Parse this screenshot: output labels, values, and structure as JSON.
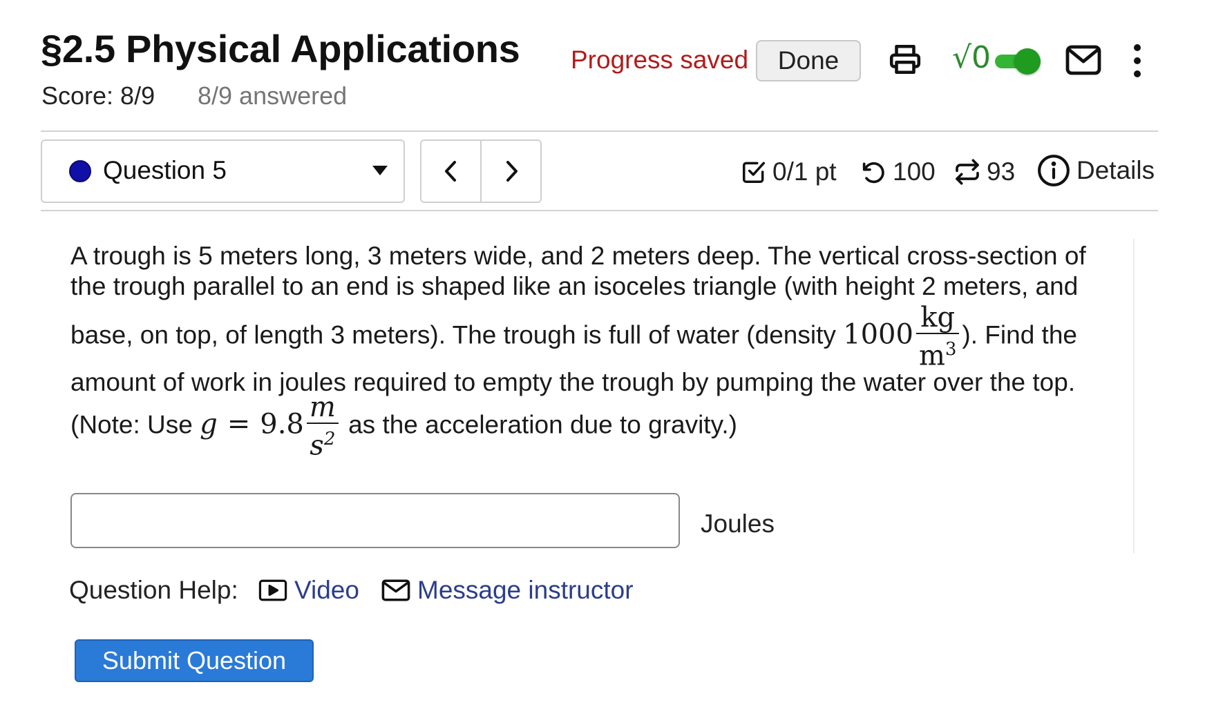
{
  "header": {
    "title": "§2.5 Physical Applications",
    "score": "Score: 8/9",
    "answered": "8/9 answered",
    "progress_status": "Progress saved",
    "done_label": "Done",
    "math_toggle_label": "√0",
    "math_toggle_on": true,
    "icons": [
      "printer-icon",
      "toggle-switch",
      "mail-icon",
      "kebab-menu-icon"
    ]
  },
  "question_nav": {
    "selected_label": "Question 5",
    "status_color": "#1010a8",
    "prev_icon": "chevron-left-icon",
    "next_icon": "chevron-right-icon"
  },
  "stats": {
    "points": "0/1 pt",
    "retries": "100",
    "attempts": "93",
    "details_label": "Details"
  },
  "question": {
    "line1": "A trough is 5 meters long, 3 meters wide, and 2 meters deep. The vertical cross-section of",
    "line2": "the trough parallel to an end is shaped like an isoceles triangle (with height 2 meters, and",
    "line3_before": "base, on top, of length 3 meters). The trough is full of water (density ",
    "density_value": "1000",
    "density_num": "kg",
    "density_den_base": "m",
    "density_den_exp": "3",
    "line3_after": "). Find the",
    "line4": "amount of work in joules required to empty the trough by pumping the water over the top.",
    "line5_before": "(Note: Use ",
    "g_symbol": "g",
    "equals": "=",
    "g_value": "9.8",
    "g_num": "m",
    "g_den_base": "s",
    "g_den_exp": "2",
    "line5_after": " as the acceleration due to gravity.)"
  },
  "answer": {
    "value": "",
    "placeholder": "",
    "unit": "Joules"
  },
  "help": {
    "label": "Question Help:",
    "video_label": "Video",
    "message_label": "Message instructor"
  },
  "submit_label": "Submit Question",
  "colors": {
    "progress_red": "#b31a1a",
    "toggle_green": "#34b534",
    "link_blue": "#2b3d8c",
    "submit_blue": "#2a7ad8"
  }
}
